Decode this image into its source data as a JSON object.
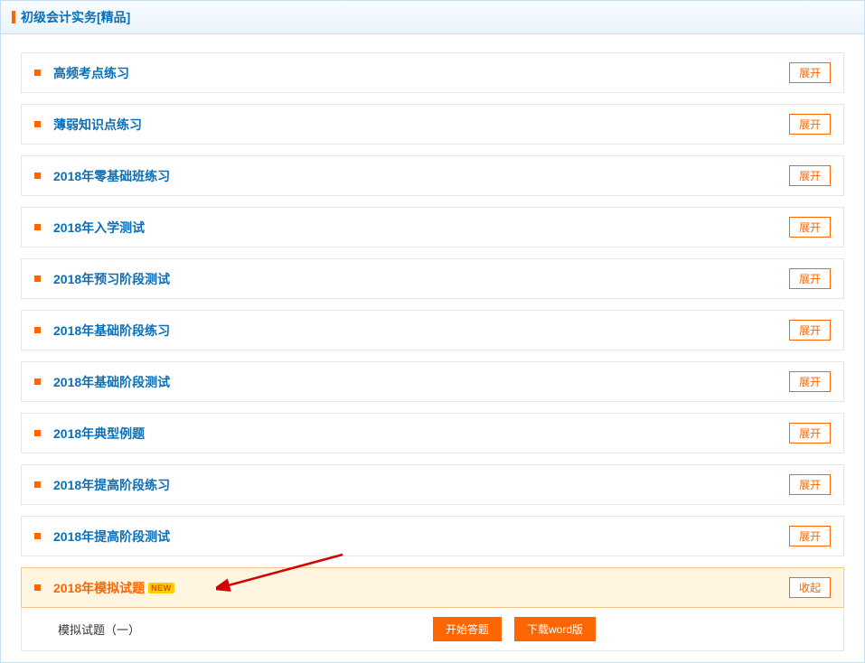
{
  "header": {
    "title": "初级会计实务[精品]"
  },
  "items": [
    {
      "title": "高频考点练习",
      "btn": "展开"
    },
    {
      "title": "薄弱知识点练习",
      "btn": "展开"
    },
    {
      "title": "2018年零基础班练习",
      "btn": "展开"
    },
    {
      "title": "2018年入学测试",
      "btn": "展开"
    },
    {
      "title": "2018年预习阶段测试",
      "btn": "展开"
    },
    {
      "title": "2018年基础阶段练习",
      "btn": "展开"
    },
    {
      "title": "2018年基础阶段测试",
      "btn": "展开"
    },
    {
      "title": "2018年典型例题",
      "btn": "展开"
    },
    {
      "title": "2018年提高阶段练习",
      "btn": "展开"
    },
    {
      "title": "2018年提高阶段测试",
      "btn": "展开"
    }
  ],
  "expanded": {
    "title": "2018年模拟试题",
    "badge": "NEW",
    "collapse_btn": "收起",
    "sub": {
      "title": "模拟试题（一）",
      "start_btn": "开始答题",
      "download_btn": "下载word版"
    }
  }
}
